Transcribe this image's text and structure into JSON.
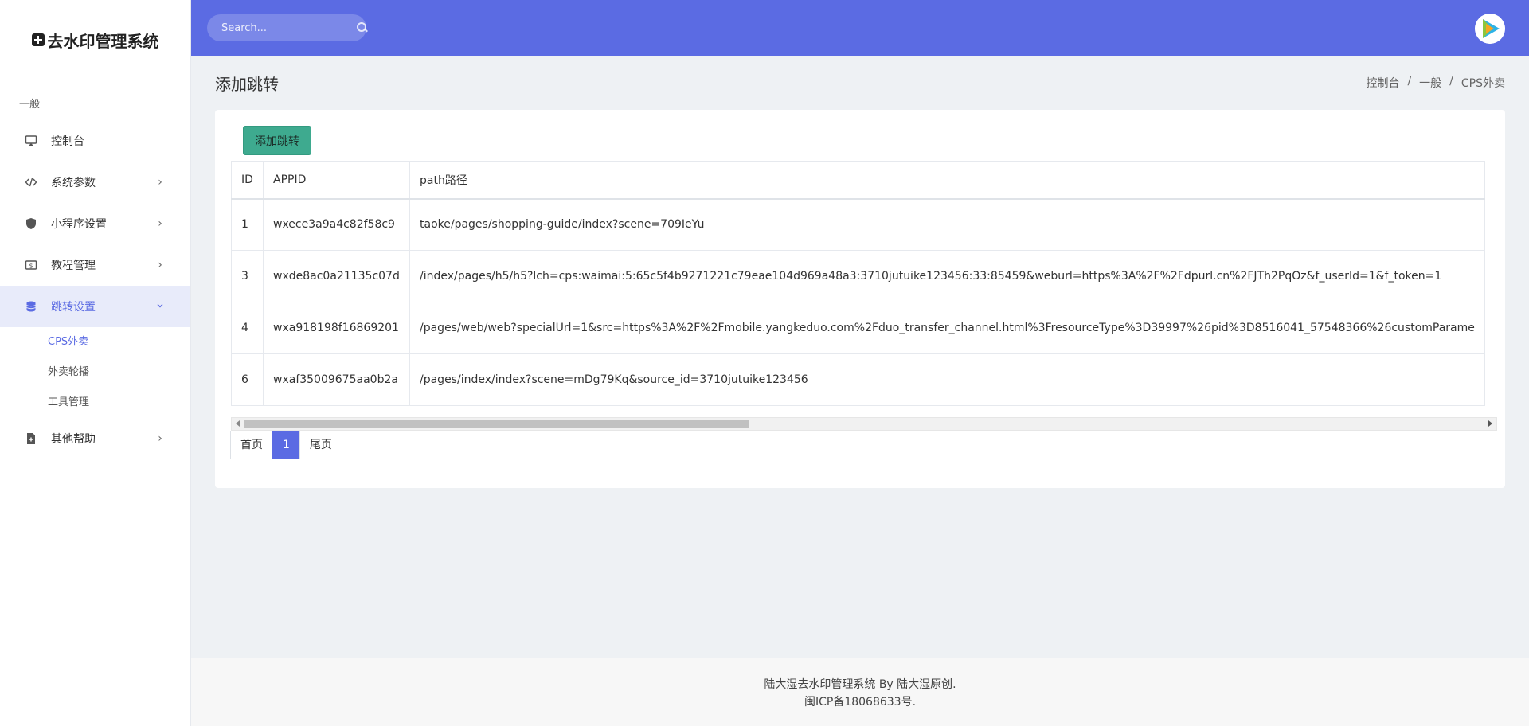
{
  "app": {
    "title": "去水印管理系统"
  },
  "sidebar": {
    "section_label": "一般",
    "items": [
      {
        "label": "控制台",
        "icon": "monitor-icon",
        "has_children": false
      },
      {
        "label": "系统参数",
        "icon": "code-icon",
        "has_children": true
      },
      {
        "label": "小程序设置",
        "icon": "shield-icon",
        "has_children": true
      },
      {
        "label": "教程管理",
        "icon": "dollar-icon",
        "has_children": true
      },
      {
        "label": "跳转设置",
        "icon": "coin-stack-icon",
        "has_children": true,
        "expanded": true
      },
      {
        "label": "其他帮助",
        "icon": "file-icon",
        "has_children": true
      }
    ],
    "sub_items": [
      {
        "label": "CPS外卖",
        "active": true
      },
      {
        "label": "外卖轮播"
      },
      {
        "label": "工具管理"
      }
    ]
  },
  "header": {
    "search": {
      "placeholder": "Search..."
    }
  },
  "page": {
    "title": "添加跳转",
    "breadcrumb": [
      "控制台",
      "一般",
      "CPS外卖"
    ]
  },
  "toolbar": {
    "add_label": "添加跳转"
  },
  "table": {
    "headers": [
      "ID",
      "APPID",
      "path路径"
    ],
    "rows": [
      [
        "1",
        "wxece3a9a4c82f58c9",
        "taoke/pages/shopping-guide/index?scene=709IeYu"
      ],
      [
        "3",
        "wxde8ac0a21135c07d",
        "/index/pages/h5/h5?lch=cps:waimai:5:65c5f4b9271221c79eae104d969a48a3:3710jutuike123456:33:85459&weburl=https%3A%2F%2Fdpurl.cn%2FJTh2PqOz&f_userId=1&f_token=1"
      ],
      [
        "4",
        "wxa918198f16869201",
        "/pages/web/web?specialUrl=1&src=https%3A%2F%2Fmobile.yangkeduo.com%2Fduo_transfer_channel.html%3FresourceType%3D39997%26pid%3D8516041_57548366%26customParame"
      ],
      [
        "6",
        "wxaf35009675aa0b2a",
        "/pages/index/index?scene=mDg79Kq&source_id=3710jutuike123456"
      ]
    ]
  },
  "pagination": {
    "first": "首页",
    "current": "1",
    "last": "尾页"
  },
  "footer": {
    "line1": "陆大湿去水印管理系统 By 陆大湿原创.",
    "line2": "闽ICP备18068633号."
  },
  "colors": {
    "accent": "#5b6be3",
    "add_button": "#3eaa8f"
  }
}
